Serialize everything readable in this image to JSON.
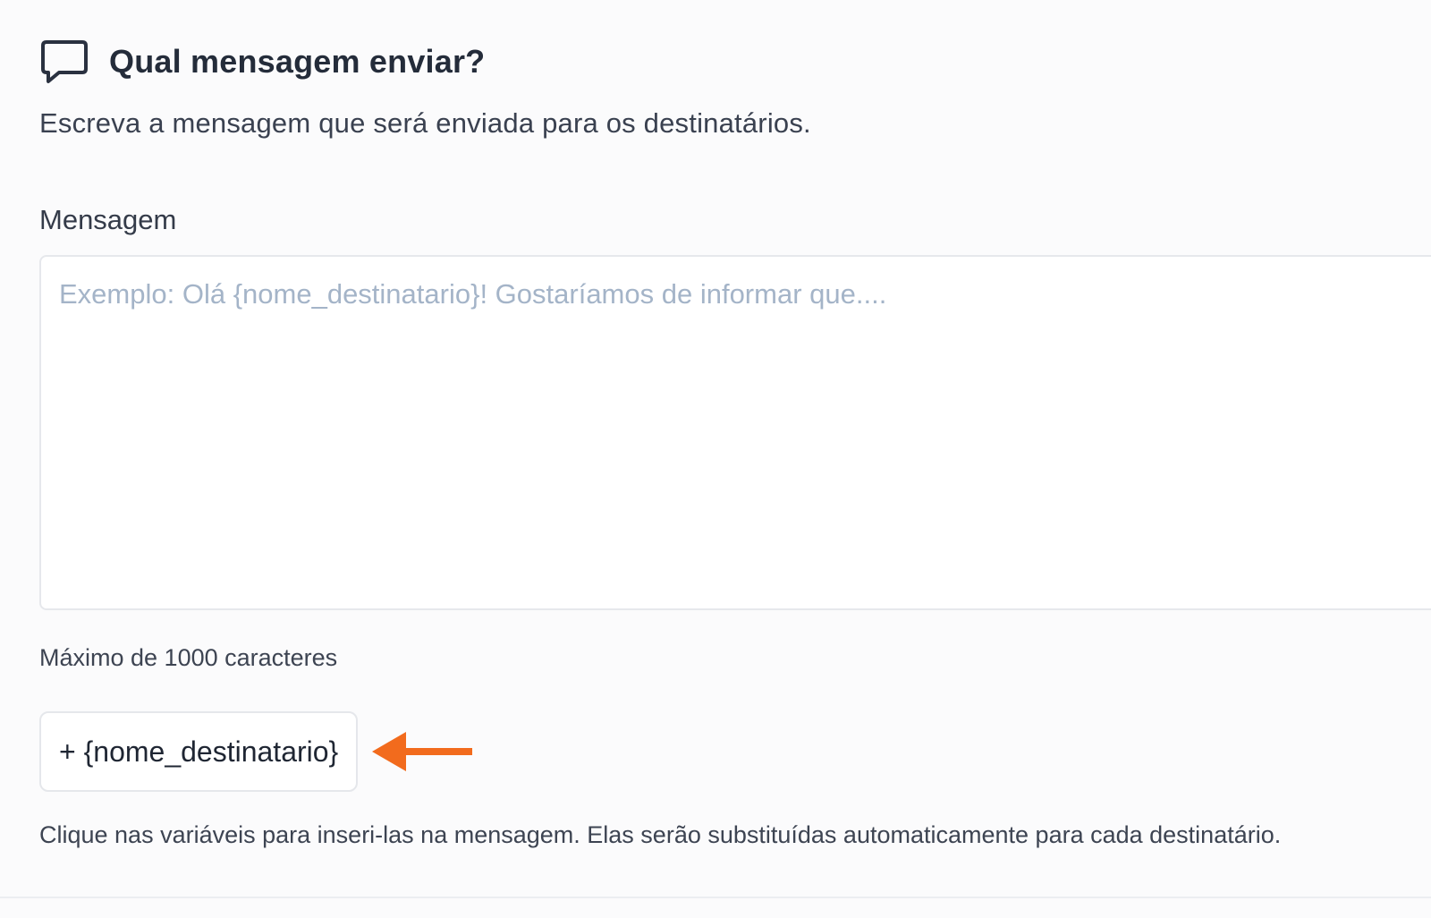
{
  "section": {
    "icon": "chat-bubble-icon",
    "title": "Qual mensagem enviar?",
    "subtitle": "Escreva a mensagem que será enviada para os destinatários."
  },
  "message_field": {
    "label": "Mensagem",
    "value": "",
    "placeholder": "Exemplo: Olá {nome_destinatario}! Gostaríamos de informar que....",
    "limit_hint": "Máximo de 1000 caracteres"
  },
  "variables": {
    "items": [
      {
        "label": "+ {nome_destinatario}"
      }
    ],
    "note": "Clique nas variáveis para inseri-las na mensagem. Elas serão substituídas automaticamente para cada destinatário."
  },
  "annotation": {
    "icon": "arrow-left-icon",
    "color": "#f26b1d"
  },
  "colors": {
    "placeholder": "#a4b4c8",
    "border": "#e6e8ec",
    "text": "#2c3443"
  }
}
